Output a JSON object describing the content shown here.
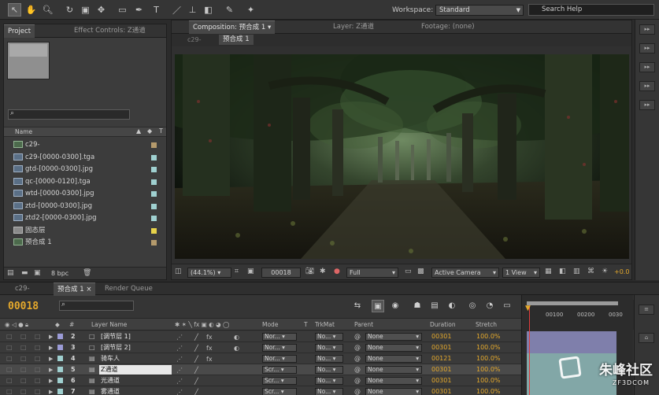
{
  "toolbar": {
    "tools": [
      "selection-tool",
      "hand-tool",
      "zoom-tool",
      "rotate-tool",
      "camera-tool",
      "pan-behind-tool",
      "rectangle-tool",
      "pen-tool",
      "type-tool",
      "brush-tool",
      "clone-stamp-tool",
      "eraser-tool",
      "roto-brush-tool",
      "puppet-tool"
    ],
    "workspace_label": "Workspace:",
    "workspace_value": "Standard",
    "search_placeholder": "Search Help"
  },
  "project": {
    "tabs": [
      "Project",
      "Effect Controls: Z通道"
    ],
    "column_name": "Name",
    "items": [
      {
        "name": "c29-",
        "type": "comp",
        "color": "#b49a6c"
      },
      {
        "name": "c29-[0000-0300].tga",
        "type": "footage",
        "color": "#9fd0d0"
      },
      {
        "name": "gtd-[0000-0300].jpg",
        "type": "footage",
        "color": "#9fd0d0"
      },
      {
        "name": "qc-[0000-0120].tga",
        "type": "footage",
        "color": "#9fd0d0"
      },
      {
        "name": "wtd-[0000-0300].jpg",
        "type": "footage",
        "color": "#9fd0d0"
      },
      {
        "name": "ztd-[0000-0300].jpg",
        "type": "footage",
        "color": "#9fd0d0"
      },
      {
        "name": "ztd2-[0000-0300].jpg",
        "type": "footage",
        "color": "#9fd0d0"
      },
      {
        "name": "固态层",
        "type": "folder",
        "color": "#e6d24a"
      },
      {
        "name": "预合成 1",
        "type": "comp",
        "color": "#b49a6c"
      }
    ],
    "bpc": "8 bpc"
  },
  "composition": {
    "tabs": [
      "Composition: 预合成 1",
      "Layer: Z通道",
      "Footage: (none)"
    ],
    "breadcrumbs": [
      "c29-",
      "预合成 1"
    ],
    "zoom": "(44.1%)",
    "timecode": "00018",
    "resolution": "Full",
    "camera": "Active Camera",
    "views": "1 View",
    "exposure": "+0.0"
  },
  "timeline": {
    "tabs": [
      "c29-",
      "预合成 1",
      "Render Queue"
    ],
    "current_time": "00018",
    "columns": {
      "layer_name": "Layer Name",
      "mode": "Mode",
      "t": "T",
      "trkmat": "TrkMat",
      "parent": "Parent",
      "duration": "Duration",
      "stretch": "Stretch"
    },
    "ruler": [
      "00100",
      "00200",
      "0030"
    ],
    "layers": [
      {
        "num": "2",
        "name": "[调节层 1]",
        "color": "#9b9bd6",
        "mode": "Nor...",
        "trkmat": "No...",
        "parent": "None",
        "duration": "00301",
        "stretch": "100.0%"
      },
      {
        "num": "3",
        "name": "[调节层 2]",
        "color": "#9b9bd6",
        "mode": "Nor...",
        "trkmat": "No...",
        "parent": "None",
        "duration": "00301",
        "stretch": "100.0%"
      },
      {
        "num": "4",
        "name": "骑车人",
        "color": "#9fd0d0",
        "mode": "Nor...",
        "trkmat": "No...",
        "parent": "None",
        "duration": "00121",
        "stretch": "100.0%"
      },
      {
        "num": "5",
        "name": "Z通道",
        "color": "#9fd0d0",
        "mode": "Scr...",
        "trkmat": "No...",
        "parent": "None",
        "duration": "00301",
        "stretch": "100.0%"
      },
      {
        "num": "6",
        "name": "光通道",
        "color": "#9fd0d0",
        "mode": "Scr...",
        "trkmat": "No...",
        "parent": "None",
        "duration": "00301",
        "stretch": "100.0%"
      },
      {
        "num": "7",
        "name": "雾通道",
        "color": "#9fd0d0",
        "mode": "Scr...",
        "trkmat": "No...",
        "parent": "None",
        "duration": "00301",
        "stretch": "100.0%"
      }
    ]
  },
  "watermark": {
    "text": "朱峰社区",
    "sub": "ZF3DCOM"
  }
}
